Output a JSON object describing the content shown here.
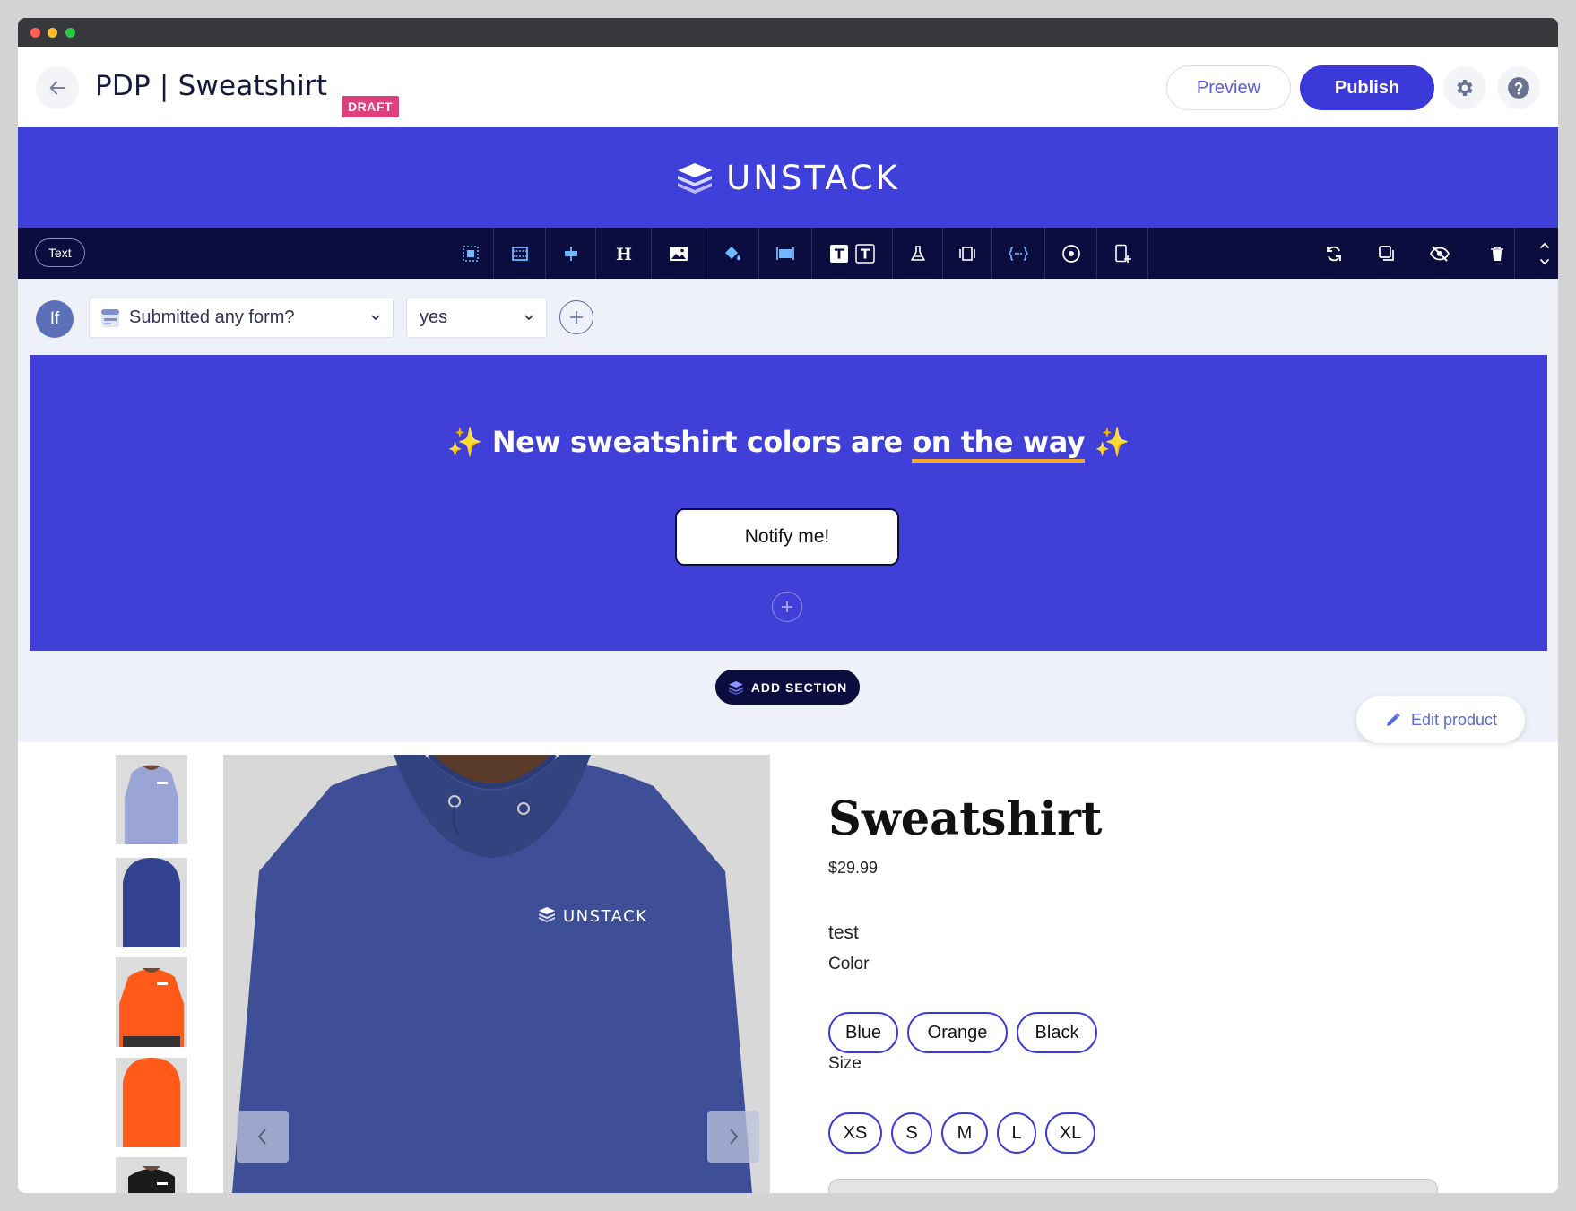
{
  "header": {
    "page_title": "PDP | Sweatshirt",
    "status_badge": "DRAFT",
    "preview_label": "Preview",
    "publish_label": "Publish"
  },
  "brand": {
    "name": "UNSTACK"
  },
  "toolbar": {
    "element_type": "Text",
    "tools": [
      "select-icon",
      "section-width-icon",
      "align-icon",
      "heading-icon",
      "image-icon",
      "fill-color-icon",
      "layout-icon",
      "text-style-icon",
      "test-icon",
      "columns-icon",
      "code-icon",
      "target-icon",
      "mobile-add-icon"
    ],
    "right_tools": [
      "sync-icon",
      "duplicate-icon",
      "hide-icon",
      "delete-icon",
      "reorder-icon"
    ]
  },
  "condition": {
    "if_label": "If",
    "field_value": "Submitted any form?",
    "operator_value": "yes"
  },
  "hero": {
    "sparkle_left": "✨",
    "title_part1": "New sweatshirt colors are ",
    "title_underlined": "on the way",
    "sparkle_right": "✨",
    "button_label": "Notify me!"
  },
  "add_section_label": "ADD SECTION",
  "edit_product_label": "Edit product",
  "product": {
    "name": "Sweatshirt",
    "price": "$29.99",
    "description": "test",
    "color_label": "Color",
    "colors": [
      "Blue",
      "Orange",
      "Black"
    ],
    "size_label": "Size",
    "sizes": [
      "XS",
      "S",
      "M",
      "L",
      "XL"
    ],
    "image_logo_text": "UNSTACK"
  },
  "colors": {
    "accent": "#3b3ad9",
    "brand_bar": "#3f3fd9",
    "toolbar": "#0b0d3f",
    "draft_badge": "#e03e7c"
  }
}
